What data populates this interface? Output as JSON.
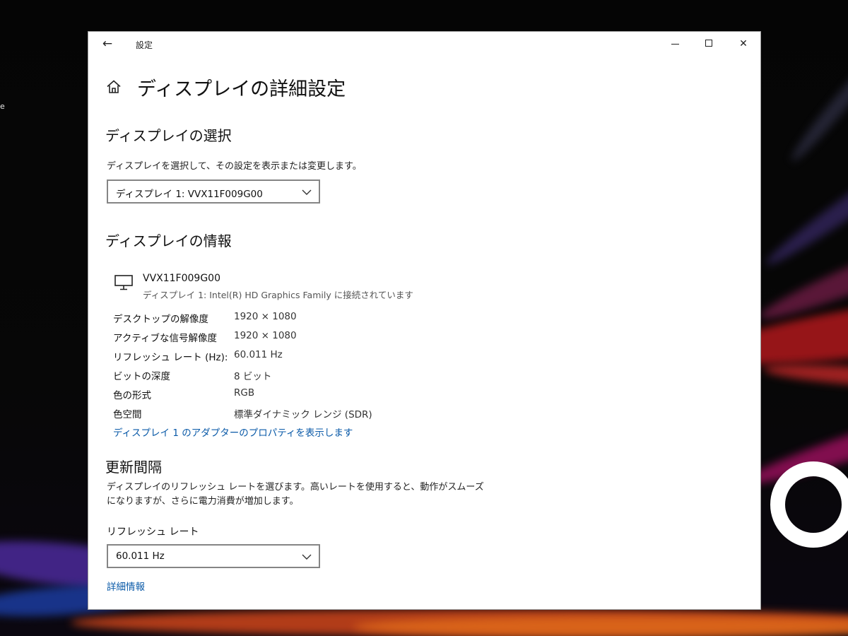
{
  "desktop": {
    "edge_text": "e"
  },
  "window": {
    "title": "設定",
    "back_glyph": "←",
    "close_glyph": "✕",
    "page_title": "ディスプレイの詳細設定",
    "icons": {
      "back": "back-arrow-icon",
      "home": "home-icon",
      "minimize": "minimize-icon",
      "maximize": "maximize-icon",
      "close": "close-icon",
      "monitor": "monitor-icon",
      "dropdown": "chevron-down-icon"
    }
  },
  "display_select": {
    "heading": "ディスプレイの選択",
    "description": "ディスプレイを選択して、その設定を表示または変更します。",
    "selected": "ディスプレイ 1: VVX11F009G00"
  },
  "display_info": {
    "heading": "ディスプレイの情報",
    "monitor_name": "VVX11F009G00",
    "monitor_connection": "ディスプレイ 1: Intel(R) HD Graphics Family に接続されています",
    "rows": [
      {
        "label": "デスクトップの解像度",
        "value": "1920 × 1080"
      },
      {
        "label": "アクティブな信号解像度",
        "value": "1920 × 1080"
      },
      {
        "label": "リフレッシュ レート (Hz):",
        "value": "60.011 Hz"
      },
      {
        "label": "ビットの深度",
        "value": "8 ビット"
      },
      {
        "label": "色の形式",
        "value": "RGB"
      },
      {
        "label": "色空間",
        "value": "標準ダイナミック レンジ (SDR)"
      }
    ],
    "adapter_link": "ディスプレイ 1 のアダプターのプロパティを表示します"
  },
  "refresh": {
    "heading": "更新間隔",
    "description_line1": "ディスプレイのリフレッシュ レートを選びます。高いレートを使用すると、動作がスムーズ",
    "description_line2": "になりますが、さらに電力消費が増加します。",
    "rate_label": "リフレッシュ レート",
    "rate_selected": "60.011 Hz",
    "more_info_link": "詳細情報"
  },
  "colors": {
    "link": "#0a5aa8",
    "window_bg": "#ffffff",
    "select_border": "#858585"
  }
}
